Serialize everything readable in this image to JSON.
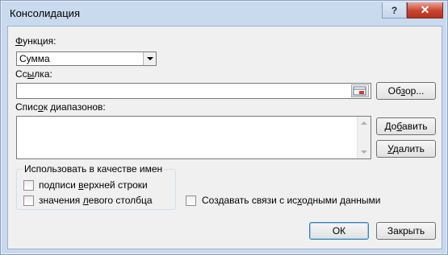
{
  "dialog": {
    "title": "Консолидация",
    "help_label": "?",
    "close_label": "✕"
  },
  "function": {
    "label": "Функция:",
    "selected": "Сумма"
  },
  "reference": {
    "label": "Ссылка:",
    "value": "",
    "browse_label": "Обзор..."
  },
  "ranges": {
    "label": "Список диапазонов:",
    "items": [],
    "add_label": "Добавить",
    "delete_label": "Удалить"
  },
  "use_labels": {
    "title": "Использовать в качестве имен",
    "top_row_label": "подписи верхней строки",
    "top_row_checked": false,
    "left_column_label": "значения левого столбца",
    "left_column_checked": false
  },
  "links": {
    "label": "Создавать связи с исходными данными",
    "checked": false
  },
  "footer": {
    "ok_label": "ОК",
    "close_label": "Закрыть"
  }
}
